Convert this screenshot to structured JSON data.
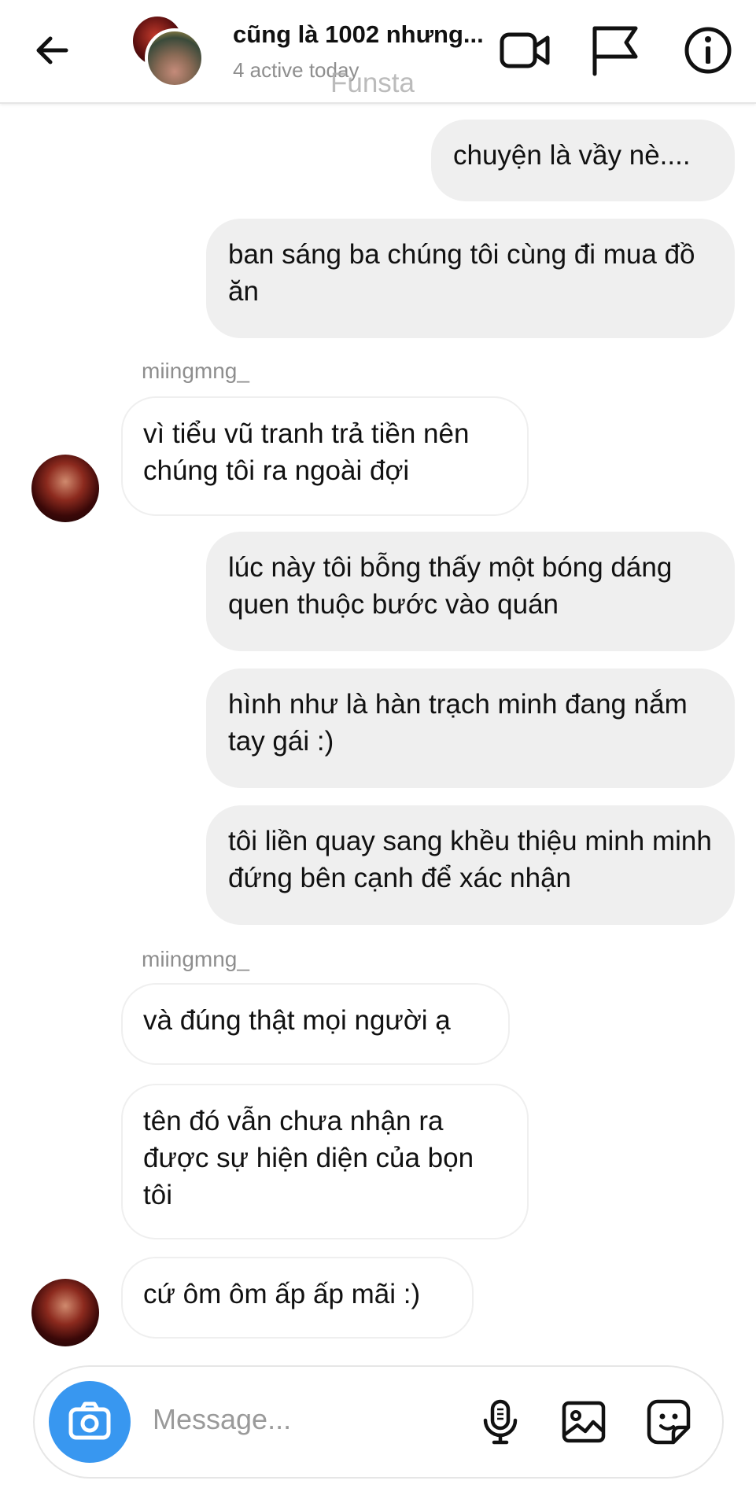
{
  "header": {
    "title": "cũng là 1002 nhưng...",
    "status": "4 active today",
    "watermark": "Funsta",
    "icons": [
      "back-arrow-icon",
      "video-call-icon",
      "flag-icon",
      "info-icon"
    ]
  },
  "messages": [
    {
      "direction": "outgoing",
      "text": "chuyện là vầy nè...."
    },
    {
      "direction": "outgoing",
      "text": "ban sáng ba chúng tôi cùng đi mua đồ ăn"
    },
    {
      "direction": "incoming",
      "sender": "miingmng_",
      "text": "vì tiểu vũ tranh trả tiền nên chúng tôi ra ngoài đợi"
    },
    {
      "direction": "outgoing",
      "text": "lúc này tôi bỗng thấy một bóng dáng quen thuộc bước vào quán"
    },
    {
      "direction": "outgoing",
      "text": "hình như là hàn trạch minh đang nắm tay gái :)"
    },
    {
      "direction": "outgoing",
      "text": "tôi liền quay sang khều thiệu minh minh đứng bên cạnh để xác nhận"
    },
    {
      "direction": "incoming",
      "sender": "miingmng_",
      "text": "và đúng thật mọi người ạ"
    },
    {
      "direction": "incoming",
      "text": "tên đó vẫn chưa nhận ra được sự hiện diện của bọn tôi"
    },
    {
      "direction": "incoming",
      "text": "cứ ôm ôm ấp ấp mãi :)"
    }
  ],
  "composer": {
    "placeholder": "Message...",
    "icons": [
      "camera-icon",
      "microphone-icon",
      "gallery-icon",
      "sticker-icon"
    ]
  },
  "colors": {
    "accent": "#3897f0",
    "outgoing_bubble": "#efefef",
    "incoming_border": "#efefef",
    "muted_text": "#8e8e8e"
  }
}
